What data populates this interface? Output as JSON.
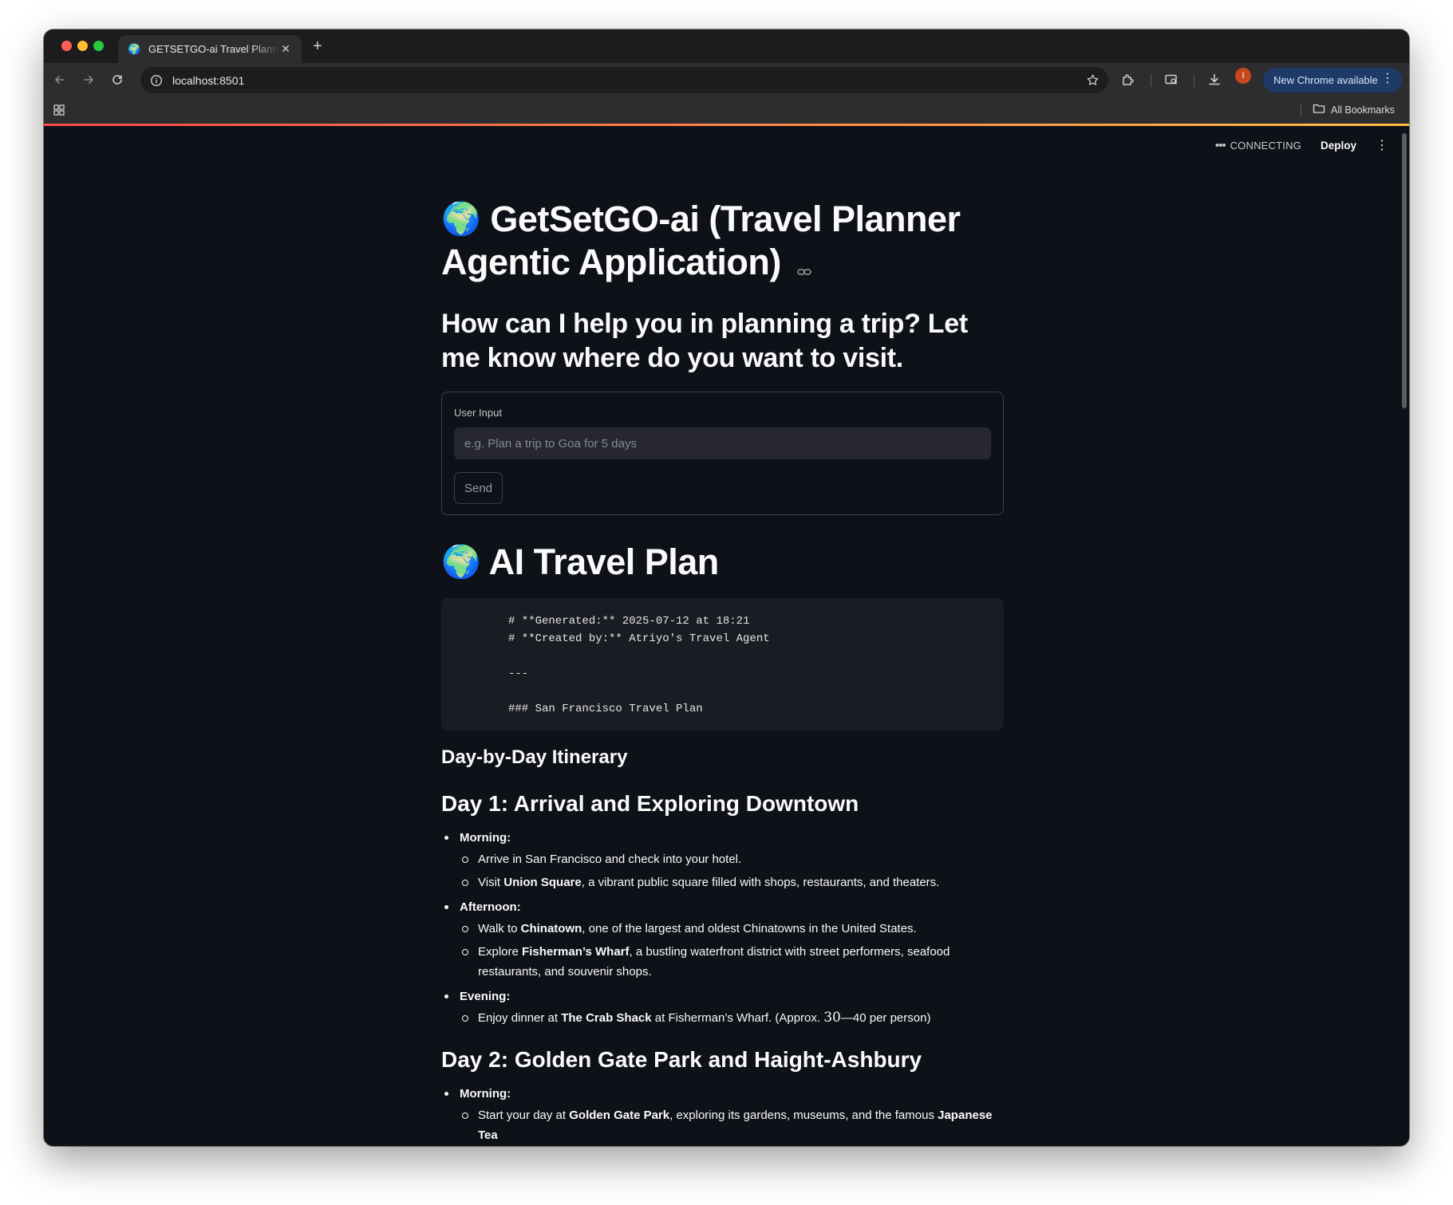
{
  "browser": {
    "tab_title": "GETSETGO-ai Travel Planner",
    "tab_favicon": "🌍",
    "url": "localhost:8501",
    "profile_initial": "I",
    "update_label": "New Chrome available",
    "all_bookmarks_label": "All Bookmarks"
  },
  "app_header": {
    "status_label": "CONNECTING",
    "deploy_label": "Deploy"
  },
  "page": {
    "title_emoji": "🌍",
    "title": "GetSetGO-ai (Travel Planner Agentic Application)",
    "subtitle": "How can I help you in planning a trip? Let me know where do you want to visit.",
    "form": {
      "label": "User Input",
      "placeholder": "e.g. Plan a trip to Goa for 5 days",
      "value": "",
      "send_label": "Send"
    },
    "plan_heading_emoji": "🌍",
    "plan_heading": "AI Travel Plan",
    "code_lines": [
      "# **Generated:** 2025-07-12 at 18:21",
      "# **Created by:** Atriyo's Travel Agent",
      "",
      "---",
      "",
      "### San Francisco Travel Plan"
    ],
    "itinerary_heading": "Day-by-Day Itinerary",
    "day1": {
      "title": "Day 1: Arrival and Exploring Downtown",
      "morning_label": "Morning:",
      "m1": "Arrive in San Francisco and check into your hotel.",
      "m2_pre": "Visit ",
      "m2_bold": "Union Square",
      "m2_post": ", a vibrant public square filled with shops, restaurants, and theaters.",
      "afternoon_label": "Afternoon:",
      "a1_pre": "Walk to ",
      "a1_bold": "Chinatown",
      "a1_post": ", one of the largest and oldest Chinatowns in the United States.",
      "a2_pre": "Explore ",
      "a2_bold": "Fisherman’s Wharf",
      "a2_post": ", a bustling waterfront district with street performers, seafood restaurants, and souvenir shops.",
      "evening_label": "Evening:",
      "e1_pre": "Enjoy dinner at ",
      "e1_bold": "The Crab Shack",
      "e1_post": " at Fisherman’s Wharf. (Approx. ",
      "e1_math": "30",
      "e1_end": "—40 per person)"
    },
    "day2": {
      "title": "Day 2: Golden Gate Park and Haight-Ashbury",
      "morning_label": "Morning:",
      "m1_pre": "Start your day at ",
      "m1_bold": "Golden Gate Park",
      "m1_post": ", exploring its gardens, museums, and the famous ",
      "m1_bold2": "Japanese Tea"
    }
  }
}
